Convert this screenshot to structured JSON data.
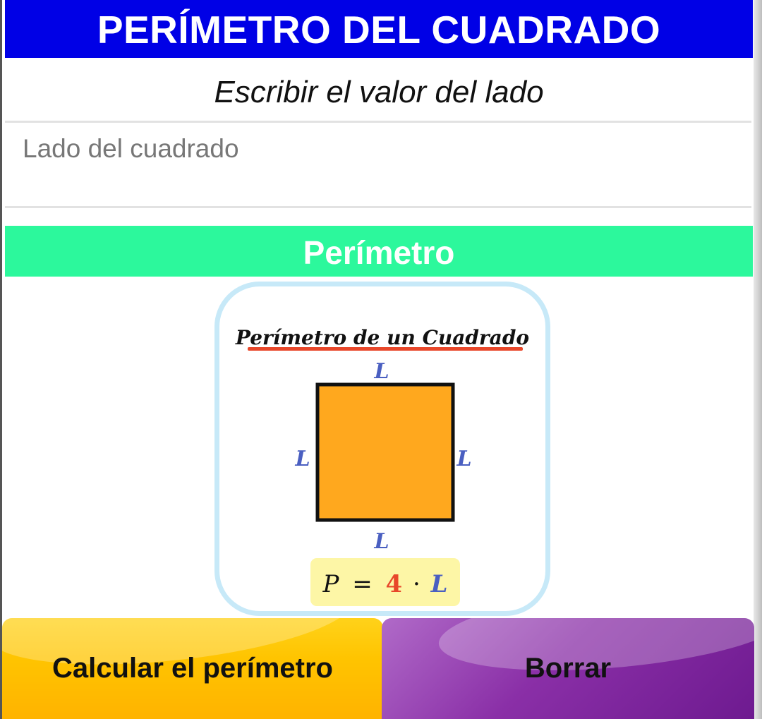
{
  "header": {
    "title": "PERÍMETRO DEL CUADRADO"
  },
  "form": {
    "instruction": "Escribir el valor del lado",
    "side_input": {
      "placeholder": "Lado del cuadrado",
      "value": ""
    }
  },
  "result": {
    "label": "Perímetro"
  },
  "illustration": {
    "heading": "Perímetro de un Cuadrado",
    "side_label": "L",
    "formula": {
      "lhs": "P",
      "equals": "=",
      "coefficient": "4",
      "dot": "·",
      "variable": "L"
    },
    "colors": {
      "square_fill": "#ffa81e",
      "side_label": "#4a5fc1",
      "coefficient": "#e8472a",
      "underline": "#e8472a",
      "formula_bg": "#fdf6a6",
      "card_border": "#c7e9f8"
    }
  },
  "buttons": {
    "calculate_label": "Calcular el perímetro",
    "clear_label": "Borrar"
  },
  "theme": {
    "title_bg": "#0000e6",
    "result_bg": "#2cf89c",
    "calculate_bg": "#ffc400",
    "clear_bg": "#8a2fa7"
  }
}
